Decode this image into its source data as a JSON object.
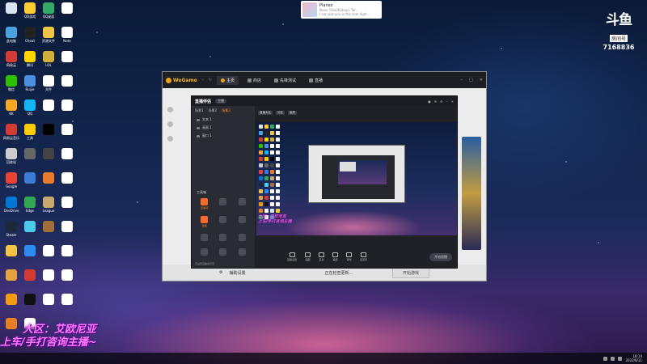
{
  "notification": {
    "title": "Planez",
    "subtitle": "Neon Tribe/Katelyn Tar...",
    "body": "I can put you in the side high..."
  },
  "brand": {
    "logo": "斗鱼",
    "room_label": "房间号",
    "room_number": "7168836"
  },
  "desktop_icons": [
    {
      "label": "",
      "color": "#d8e4f0"
    },
    {
      "label": "QQ游戏",
      "color": "#ffcc33"
    },
    {
      "label": "QQ桌面",
      "color": "#33aa66"
    },
    {
      "label": "",
      "color": "#ffffff"
    },
    {
      "label": "此电脑",
      "color": "#4aa3df"
    },
    {
      "label": "Cheat",
      "color": "#222222"
    },
    {
      "label": "资源文件",
      "color": "#f3c443"
    },
    {
      "label": "Note",
      "color": "#ffffff"
    },
    {
      "label": "网易云",
      "color": "#d33a31"
    },
    {
      "label": "腾讯",
      "color": "#ffd700"
    },
    {
      "label": "LOL",
      "color": "#d4af37"
    },
    {
      "label": "",
      "color": "#ffffff"
    },
    {
      "label": "微信",
      "color": "#2dc100"
    },
    {
      "label": "Ruijie",
      "color": "#4a90e2"
    },
    {
      "label": "文件",
      "color": "#ffffff"
    },
    {
      "label": "",
      "color": "#ffffff"
    },
    {
      "label": "KK",
      "color": "#f5a623"
    },
    {
      "label": "QQ",
      "color": "#12b7f5"
    },
    {
      "label": "",
      "color": "#ffffff"
    },
    {
      "label": "",
      "color": "#ffffff"
    },
    {
      "label": "网易云音乐",
      "color": "#d33a31"
    },
    {
      "label": "工具",
      "color": "#ffcc00"
    },
    {
      "label": "",
      "color": "#000000"
    },
    {
      "label": "",
      "color": "#ffffff"
    },
    {
      "label": "回收站",
      "color": "#cccccc"
    },
    {
      "label": "",
      "color": "#666666"
    },
    {
      "label": "",
      "color": "#444444"
    },
    {
      "label": "",
      "color": "#ffffff"
    },
    {
      "label": "Google",
      "color": "#ea4335"
    },
    {
      "label": "",
      "color": "#3a7bd5"
    },
    {
      "label": "",
      "color": "#e87a2a"
    },
    {
      "label": "",
      "color": "#ffffff"
    },
    {
      "label": "OneDrive",
      "color": "#0078d4"
    },
    {
      "label": "Edge",
      "color": "#33a852"
    },
    {
      "label": "League",
      "color": "#c8aa6e"
    },
    {
      "label": "",
      "color": "#ffffff"
    },
    {
      "label": "Steam",
      "color": "#1b2838"
    },
    {
      "label": "",
      "color": "#4ec9e8"
    },
    {
      "label": "",
      "color": "#a36d3a"
    },
    {
      "label": "",
      "color": "#ffffff"
    },
    {
      "label": "",
      "color": "#f3c443"
    },
    {
      "label": "",
      "color": "#2d8cf0"
    },
    {
      "label": "",
      "color": "#ffffff"
    },
    {
      "label": "",
      "color": "#ffffff"
    },
    {
      "label": "",
      "color": "#e6a23c"
    },
    {
      "label": "",
      "color": "#d33a31"
    },
    {
      "label": "",
      "color": "#ffffff"
    },
    {
      "label": "",
      "color": "#ffffff"
    },
    {
      "label": "",
      "color": "#f39c12"
    },
    {
      "label": "",
      "color": "#111111"
    },
    {
      "label": "",
      "color": "#ffffff"
    },
    {
      "label": "",
      "color": "#ffffff"
    },
    {
      "label": "",
      "color": "#e67e22"
    },
    {
      "label": "",
      "color": "#ffffff"
    }
  ],
  "wegame": {
    "logo": "WeGame",
    "tabs": [
      {
        "label": "主页",
        "active": true
      },
      {
        "label": "商店",
        "active": false
      },
      {
        "label": "先锋测试",
        "active": false
      },
      {
        "label": "直播",
        "active": false
      }
    ],
    "window_controls": [
      "–",
      "□",
      "✕"
    ],
    "bottom_text": "辅助设置",
    "bottom_status": "正在检查更新...",
    "start_button": "开始游戏"
  },
  "live_tool": {
    "title": "直播伴侣",
    "badge": "主播",
    "left_tabs": [
      {
        "label": "场景1",
        "active": false
      },
      {
        "label": "场景2",
        "active": false
      },
      {
        "label": "场景3",
        "active": true
      }
    ],
    "scenes": [
      "文本 1",
      "画面 1",
      "窗口 1"
    ],
    "tools_title": "工具箱",
    "tools": [
      {
        "label": "直播间",
        "hot": true
      },
      {
        "label": "",
        "hot": false
      },
      {
        "label": "",
        "hot": false
      },
      {
        "label": "直播",
        "hot": true
      },
      {
        "label": "",
        "hot": false
      },
      {
        "label": "",
        "hot": false
      },
      {
        "label": "",
        "hot": false
      },
      {
        "label": "",
        "hot": false
      },
      {
        "label": "",
        "hot": false
      },
      {
        "label": "",
        "hot": false
      },
      {
        "label": "",
        "hot": false
      },
      {
        "label": "",
        "hot": false
      }
    ],
    "footer": "已设置直播间背景",
    "info_items": [
      "直播大区",
      "分区",
      "画质"
    ],
    "preview_overlay": [
      "大区：艾欧尼亚",
      "上车/手打咨询主播"
    ],
    "bottom_buttons": [
      "直播设置",
      "画面",
      "互动",
      "美颜",
      "音效",
      "麦克风"
    ],
    "go_live": "开始直播"
  },
  "streamer_overlay": {
    "line1": "大区：艾欧尼亚",
    "line2": "上车/手打咨询主播~"
  },
  "taskbar": {
    "time": "18:14",
    "date": "2022/8/11"
  }
}
